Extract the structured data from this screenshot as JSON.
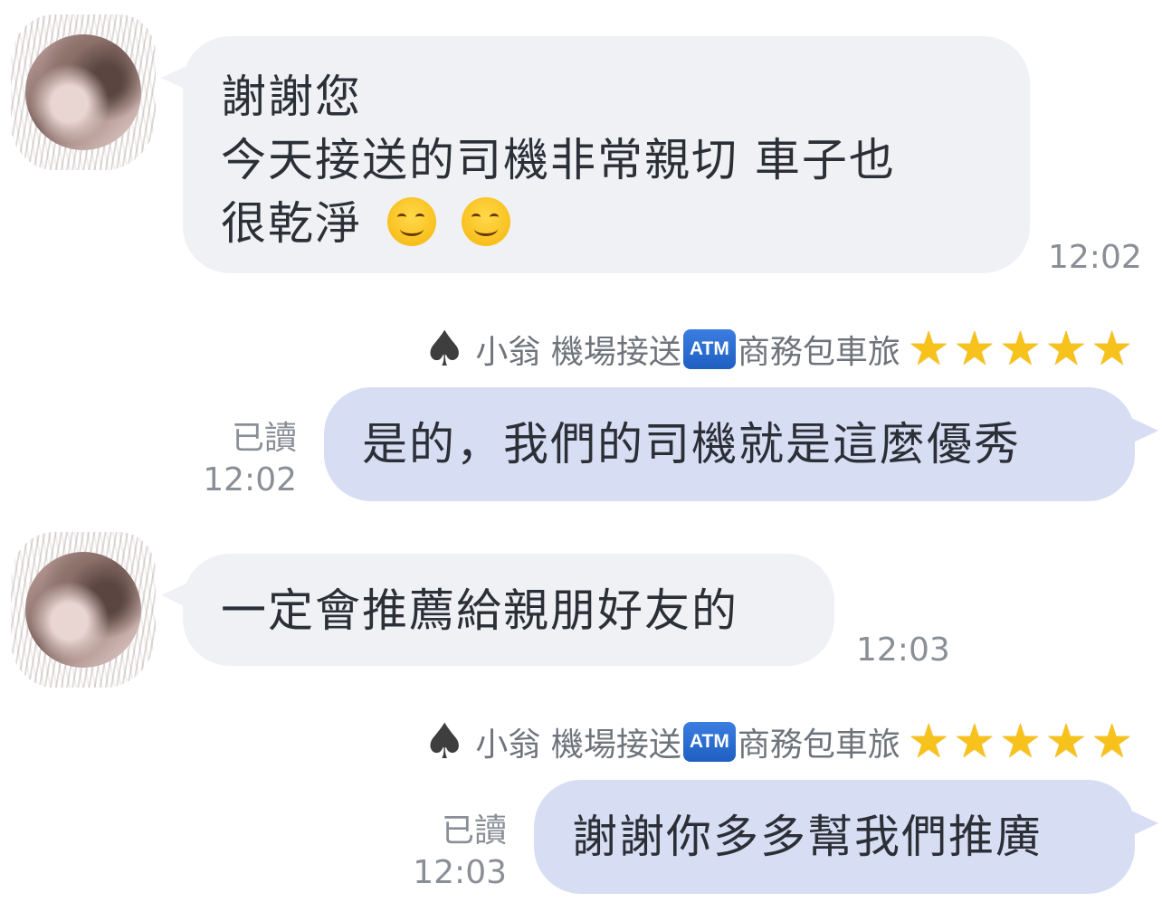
{
  "messages": [
    {
      "lines": [
        "謝謝您",
        "今天接送的司機非常親切 車子也",
        "很乾淨"
      ],
      "emoji_count": 2,
      "emoji": "smiling-face-icon",
      "time": "12:02"
    },
    {
      "sender": {
        "name": "小翁 機場接送",
        "badge": "ATM",
        "suffix": "商務包車旅",
        "stars": "★★★★★"
      },
      "text": "是的，我們的司機就是這麼優秀",
      "read": "已讀",
      "time": "12:02"
    },
    {
      "text": "一定會推薦給親朋好友的",
      "time": "12:03"
    },
    {
      "sender": {
        "name": "小翁 機場接送",
        "badge": "ATM",
        "suffix": "商務包車旅",
        "stars": "★★★★★"
      },
      "text": "謝謝你多多幫我們推廣",
      "read": "已讀",
      "time": "12:03"
    }
  ],
  "icons": {
    "spade": "♠",
    "avatar": "blurred-user-avatar"
  },
  "colors": {
    "incoming_bubble": "#f0f1f4",
    "outgoing_bubble": "#d7def4",
    "meta_text": "#8a8f97",
    "star": "#f6c21b",
    "atm_badge": "#2a6fd6"
  }
}
